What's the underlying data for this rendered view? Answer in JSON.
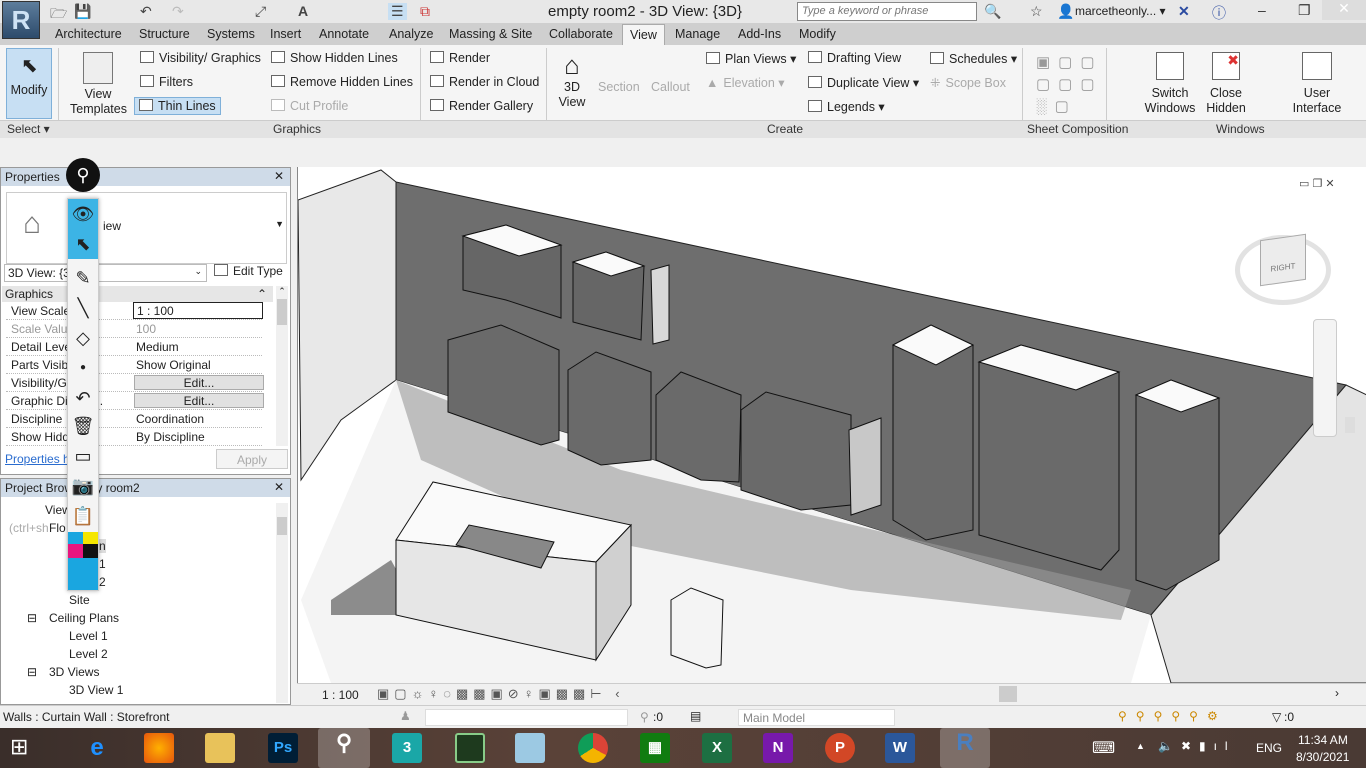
{
  "app": {
    "logo": "R",
    "title": "empty room2 - 3D View: {3D}",
    "search_placeholder": "Type a keyword or phrase",
    "user": "marcetheonly...",
    "user_caret": "▾"
  },
  "tabs": [
    "Architecture",
    "Structure",
    "Systems",
    "Insert",
    "Annotate",
    "Analyze",
    "Massing & Site",
    "Collaborate",
    "View",
    "Manage",
    "Add-Ins",
    "Modify"
  ],
  "active_tab": "View",
  "ribbon": {
    "select": {
      "modify": "Modify",
      "select": "Select ▾"
    },
    "graphics": {
      "view_templates": "View Templates",
      "visibility": "Visibility/ Graphics",
      "filters": "Filters",
      "thin_lines": "Thin Lines",
      "show_hidden": "Show Hidden Lines",
      "remove_hidden": "Remove Hidden Lines",
      "cut_profile": "Cut Profile",
      "render": "Render",
      "render_cloud": "Render in Cloud",
      "render_gallery": "Render Gallery",
      "label": "Graphics"
    },
    "create": {
      "view3d": "3D View",
      "section": "Section",
      "callout": "Callout",
      "plan_views": "Plan Views ▾",
      "elevation": "Elevation ▾",
      "legends": "Legends ▾",
      "drafting": "Drafting View",
      "duplicate": "Duplicate View ▾",
      "schedules": "Schedules ▾",
      "scope_box": "Scope Box",
      "label": "Create"
    },
    "sheet": {
      "label": "Sheet Composition"
    },
    "windows": {
      "switch": "Switch Windows",
      "close_hidden": "Close Hidden",
      "user_interface": "User Interface",
      "label": "Windows"
    }
  },
  "properties": {
    "title": "Properties",
    "type_name": "iew",
    "selector": "3D View: {3",
    "edit_type": "Edit Type",
    "section": "Graphics",
    "rows": [
      {
        "k": "View Scale",
        "v": "1 : 100"
      },
      {
        "k": "Scale Value",
        "v": "100"
      },
      {
        "k": "Detail Leve",
        "v": "Medium"
      },
      {
        "k": "Parts Visibi",
        "v": "Show Original"
      },
      {
        "k": "Visibility/G       s O...",
        "v": "Edit..."
      },
      {
        "k": "Graphic Di       Opti...",
        "v": "Edit..."
      },
      {
        "k": "Discipline",
        "v": "Coordination"
      },
      {
        "k": "Show Hidd       es",
        "v": "By Discipline"
      }
    ],
    "help": "Properties h",
    "apply": "Apply"
  },
  "browser": {
    "title": "Project Brow       mpty room2",
    "items": [
      "Views",
      "Flo       s",
      "n",
      "1",
      "2",
      "Site",
      "Ceiling Plans",
      "Level 1",
      "Level 2",
      "3D Views",
      "3D View 1"
    ],
    "tooltip": "(ctrl+sh"
  },
  "viewcube": {
    "face": "RIGHT"
  },
  "view_control": {
    "scale": "1 : 100"
  },
  "status": {
    "text": "Walls : Curtain Wall : Storefront",
    "sel_count": ":0",
    "model": "Main Model",
    "filter_count": ":0"
  },
  "taskbar": {
    "lang": "ENG",
    "time": "11:34 AM",
    "date": "8/30/2021",
    "apps": [
      "e",
      "3",
      "N",
      "P",
      "W",
      "X",
      "R",
      "Ps"
    ]
  }
}
